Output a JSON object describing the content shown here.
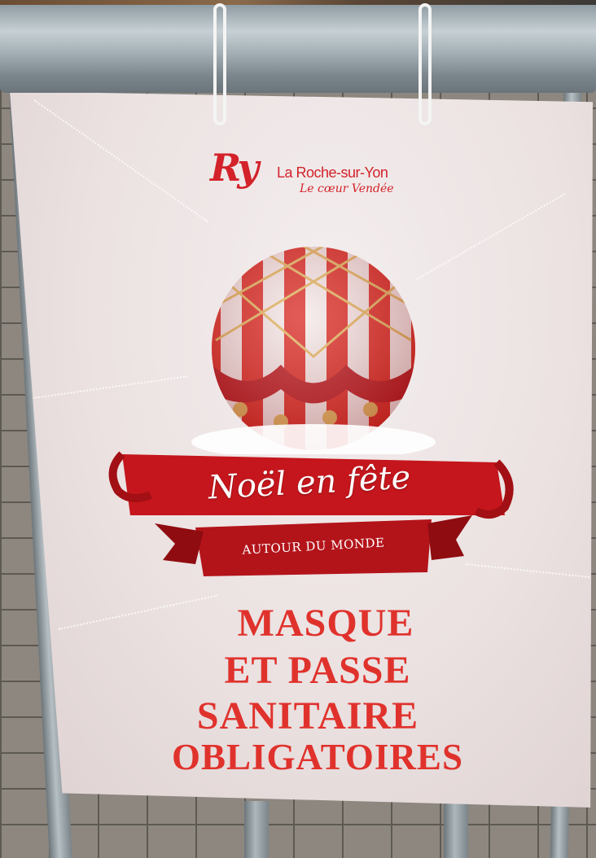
{
  "poster": {
    "logo_mark": "Ry",
    "city_name": "La Roche-sur-Yon",
    "tagline": "Le cœur Vendée",
    "event_title": "Noël en fête",
    "event_subtitle": "AUTOUR DU MONDE",
    "message_lines": [
      "MASQUE",
      "ET PASSE",
      "SANITAIRE",
      "OBLIGATOIRES"
    ]
  },
  "colors": {
    "brand_red": "#d3222a",
    "message_red": "#e0322c",
    "ornament_gold": "#e0b45a",
    "poster_bg": "#efe6e6"
  },
  "icons": {
    "ornament": "christmas-bauble-icon",
    "ribbon": "banner-ribbon-icon"
  }
}
